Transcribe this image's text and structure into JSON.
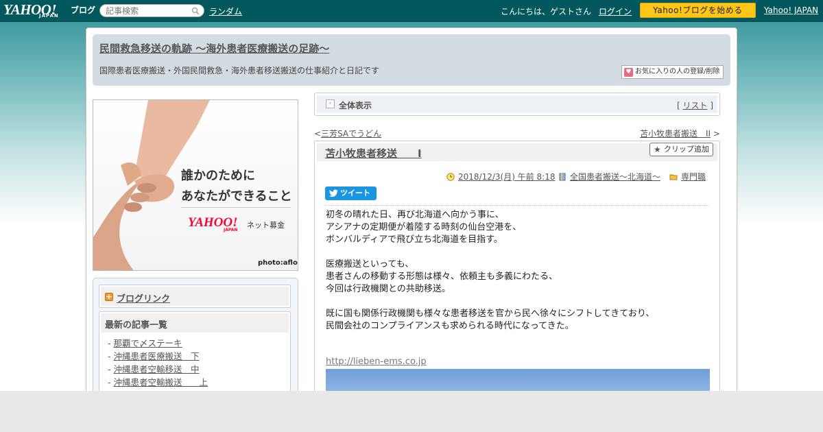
{
  "topbar": {
    "logo_text": "YAHOO!",
    "logo_sub": "JAPAN",
    "logo_blog": "ブログ",
    "search_placeholder": "記事検索",
    "random_label": "ランダム",
    "greeting": "こんにちは、ゲストさん",
    "login_label": "ログイン",
    "start_blog_label": "Yahoo!ブログを始める",
    "yahoo_japan_label": "Yahoo! JAPAN"
  },
  "blog": {
    "title": "民間救急移送の軌跡 ～海外患者医療搬送の足跡～",
    "description": "国際患者医療搬送・外国民間救急・海外患者移送搬送の仕事紹介と日記です",
    "fav_button": "お気に入りの人の登録/削除"
  },
  "ad": {
    "line1": "誰かのために",
    "line2": "あなたができること",
    "brand": "YAHOO!",
    "brand_sub": "JAPAN",
    "service": "ネット募金",
    "credit": "photo:aflo"
  },
  "sidebar": {
    "bloglink_label": "ブログリンク",
    "recent_heading": "最新の記事一覧",
    "recent_items": [
      "那覇で〆ステーキ",
      "沖縄患者医療搬送　下",
      "沖縄患者空輸移送　中",
      "沖縄患者空輸搬送　　上"
    ]
  },
  "toolbar": {
    "all_label": "全体表示",
    "list_label": "リスト"
  },
  "nav": {
    "prev": "三芳SAでうどん",
    "next": "苫小牧患者搬送　II"
  },
  "article": {
    "title": "苫小牧患者移送　　I",
    "clip_label": "クリップ追加",
    "date": "2018/12/3(月) 午前 8:18",
    "category": "全国患者搬送～北海道～",
    "folder": "専門職",
    "tweet_label": "ツイート",
    "paragraphs": [
      [
        "初冬の晴れた日、再び北海道へ向かう事に、",
        "アシアナの定期便が着陸する時刻の仙台空港を、",
        "ボンバルディアで飛び立ち北海道を目指す。"
      ],
      [
        "医療搬送といっても、",
        "患者さんの移動する形態は様々、依頼主も多義にわたる、",
        "今回は行政機関との共助移送。"
      ],
      [
        "既に国も関係行政機関も様々な患者移送を官から民へ徐々にシフトしてきており、",
        "民間会社のコンプライアンスも求められる時代になってきた。"
      ]
    ],
    "link": "http://lieben-ems.co.jp"
  }
}
